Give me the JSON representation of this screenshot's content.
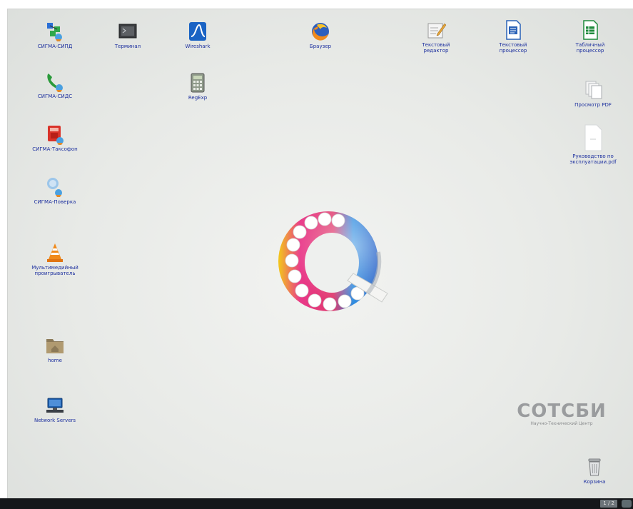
{
  "desktop": {
    "icons": [
      {
        "id": "sigma-sipd",
        "label": "СИГМА-СИПД",
        "icon": "network-nodes-icon"
      },
      {
        "id": "terminal",
        "label": "Терминал",
        "icon": "terminal-icon"
      },
      {
        "id": "wireshark",
        "label": "Wireshark",
        "icon": "wireshark-fin-icon"
      },
      {
        "id": "browser",
        "label": "Браузер",
        "icon": "firefox-icon"
      },
      {
        "id": "text-editor",
        "label": "Текстовый\nредактор",
        "icon": "text-editor-icon"
      },
      {
        "id": "word-processor",
        "label": "Текстовый\nпроцессор",
        "icon": "writer-document-icon"
      },
      {
        "id": "spreadsheet",
        "label": "Табличный\nпроцессор",
        "icon": "calc-spreadsheet-icon"
      },
      {
        "id": "sigma-sids",
        "label": "СИГМА-СИДС",
        "icon": "phone-receiver-icon"
      },
      {
        "id": "regexp",
        "label": "RegExp",
        "icon": "calculator-icon"
      },
      {
        "id": "pdf-viewer",
        "label": "Просмотр PDF",
        "icon": "pdf-pages-icon"
      },
      {
        "id": "sigma-taxophone",
        "label": "СИГМА-Таксофон",
        "icon": "payphone-icon"
      },
      {
        "id": "manual-pdf",
        "label": "Руководство по\nэксплуатации.pdf",
        "icon": "pdf-file-icon"
      },
      {
        "id": "sigma-check",
        "label": "СИГМА-Поверка",
        "icon": "verification-globe-icon"
      },
      {
        "id": "media-player",
        "label": "Мультимедийный\nпроигрыватель",
        "icon": "vlc-cone-icon"
      },
      {
        "id": "home",
        "label": "home",
        "icon": "home-folder-icon"
      },
      {
        "id": "network-servers",
        "label": "Network Servers",
        "icon": "network-servers-icon"
      },
      {
        "id": "trash",
        "label": "Корзина",
        "icon": "trash-icon"
      }
    ]
  },
  "brand": {
    "name": "СОТСБИ",
    "subtitle": "Научно-Технический Центр"
  },
  "taskbar": {
    "pager": "1 / 2"
  },
  "colors": {
    "label_text": "#1c2f9e",
    "taskbar": "#15171a",
    "brand_text": "#9a9c9e"
  }
}
